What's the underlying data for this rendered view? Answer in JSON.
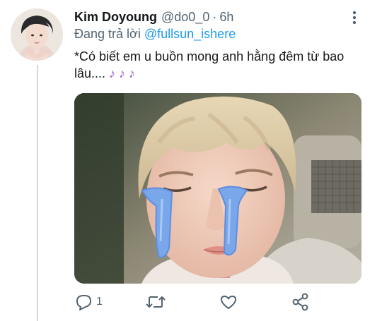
{
  "tweet": {
    "author_name": "Kim Doyoung",
    "handle": "@do0_0",
    "separator": "·",
    "time": "6h",
    "reply_prefix": "Đang trả lời",
    "reply_to": "@fullsun_ishere",
    "text": "*Có biết em u buồn mong anh hằng đêm từ bao lâu....",
    "notes": "♪ ♪ ♪",
    "media_description": "photo of a person crying with cartoon tears"
  },
  "actions": {
    "reply_count": "1",
    "retweet_count": "",
    "like_count": ""
  },
  "colors": {
    "link": "#1d9bf0",
    "muted": "#536471",
    "note": "#9b55d9",
    "thread_line": "#cfd9de"
  }
}
